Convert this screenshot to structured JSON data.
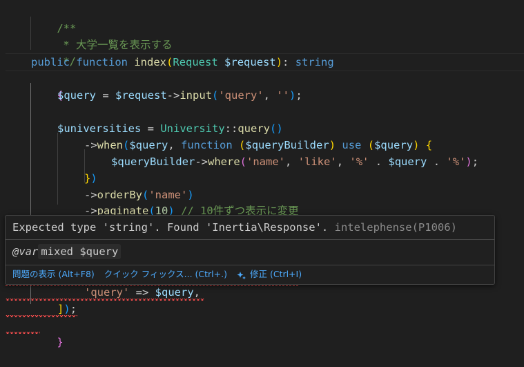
{
  "colors": {
    "background": "#1f1f1f",
    "comment": "#6a9955",
    "keyword": "#569cd6",
    "function": "#dcdcaa",
    "type": "#4ec9b0",
    "string": "#ce9178",
    "number": "#b5cea8",
    "variable": "#9cdcfe",
    "error": "#f14c4c",
    "link": "#4daafc"
  },
  "code": {
    "l1": "/**",
    "l2": "* 大学一覧を表示する",
    "l3": "*/",
    "l4": {
      "kw_public": "public",
      "kw_function": "function",
      "fn": "index",
      "paren_open": "(",
      "type": "Request",
      "space": " ",
      "param": "$request",
      "paren_close": ")",
      "colon": ": ",
      "ret": "string"
    },
    "l5": "{",
    "l6": {
      "var": "$query",
      "eq": " = ",
      "req": "$request",
      "arrow": "->",
      "fn": "input",
      "p1": "(",
      "s1": "'query'",
      "comma": ", ",
      "s2": "''",
      "p2": ")",
      "end": ";"
    },
    "l8": {
      "var": "$universities",
      "eq": " = ",
      "cls": "University",
      "op": "::",
      "fn": "query",
      "p": "()"
    },
    "l9": {
      "arrow": "->",
      "fn": "when",
      "p1": "(",
      "v": "$query",
      "comma": ", ",
      "kw": "function",
      "sp": " ",
      "p2": "(",
      "qb": "$queryBuilder",
      "p3": ")",
      "sp2": " ",
      "use": "use",
      "sp3": " ",
      "p4": "(",
      "v2": "$query",
      "p5": ")",
      "sp4": " ",
      "br": "{"
    },
    "l10": {
      "qb": "$queryBuilder",
      "arrow": "->",
      "fn": "where",
      "p1": "(",
      "s1": "'name'",
      "c1": ", ",
      "s2": "'like'",
      "c2": ", ",
      "s3": "'%'",
      "dot1": " . ",
      "v": "$query",
      "dot2": " . ",
      "s4": "'%'",
      "p2": ")",
      "end": ";"
    },
    "l11": {
      "br": "}",
      "p": ")"
    },
    "l12": {
      "arrow": "->",
      "fn": "orderBy",
      "p1": "(",
      "s": "'name'",
      "p2": ")"
    },
    "l13": {
      "arrow": "->",
      "fn": "paginate",
      "p1": "(",
      "n": "10",
      "p2": ")",
      "cm": " // 10件ずつ表示に変更"
    },
    "l17": {
      "s": "'query'",
      "op": " => ",
      "v": "$query",
      "end": ","
    },
    "l18": {
      "br": "]",
      "p": ")",
      "end": ";"
    },
    "l19": "}"
  },
  "hover": {
    "message": "Expected type 'string'. Found 'Inertia\\Response'.",
    "source": "intelephense(P1006)",
    "var_tag": "@var",
    "var_type": "mixed",
    "var_name": "$query",
    "actions": [
      {
        "label": "問題の表示 (Alt+F8)"
      },
      {
        "label": "クイック フィックス... (Ctrl+.)"
      },
      {
        "label": "修正 (Ctrl+I)",
        "icon": "sparkle-icon"
      }
    ]
  }
}
